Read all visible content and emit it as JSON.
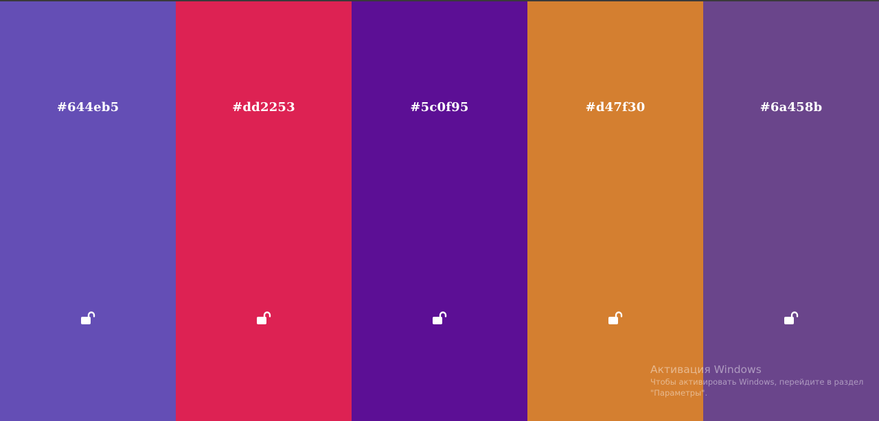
{
  "palette": {
    "columns": [
      {
        "hex": "#644eb5",
        "color": "#644eb5",
        "lock_icon": "unlocked-lock-icon"
      },
      {
        "hex": "#dd2253",
        "color": "#dd2253",
        "lock_icon": "unlocked-lock-icon"
      },
      {
        "hex": "#5c0f95",
        "color": "#5c0f95",
        "lock_icon": "unlocked-lock-icon"
      },
      {
        "hex": "#d47f30",
        "color": "#d47f30",
        "lock_icon": "unlocked-lock-icon"
      },
      {
        "hex": "#6a458b",
        "color": "#6a458b",
        "lock_icon": "unlocked-lock-icon"
      }
    ]
  },
  "windows_activation": {
    "title": "Активация Windows",
    "line1": "Чтобы активировать Windows, перейдите в раздел",
    "line2": "\"Параметры\"."
  }
}
